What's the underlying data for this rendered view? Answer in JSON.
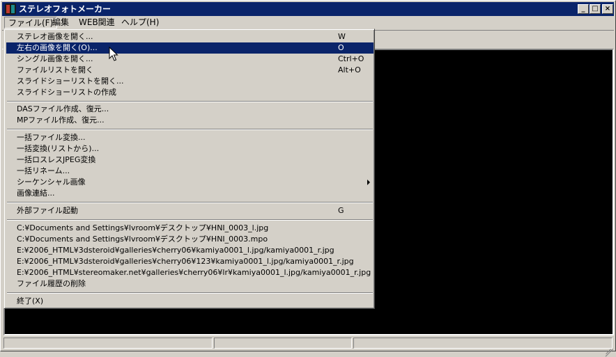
{
  "window": {
    "title": "ステレオフォトメーカー"
  },
  "title_buttons": {
    "minimize": "_",
    "maximize": "□",
    "close": "×"
  },
  "menubar": {
    "file": "ファイル(F)",
    "edit": "編集",
    "web": "WEB関連",
    "help": "ヘルプ(H)"
  },
  "file_menu": {
    "items": [
      {
        "label": "ステレオ画像を開く...",
        "shortcut": "W"
      },
      {
        "label": "左右の画像を開く(O)...",
        "shortcut": "O",
        "highlighted": true
      },
      {
        "label": "シングル画像を開く...",
        "shortcut": "Ctrl+O"
      },
      {
        "label": "ファイルリストを開く",
        "shortcut": "Alt+O"
      },
      {
        "label": "スライドショーリストを開く..."
      },
      {
        "label": "スライドショーリストの作成"
      },
      {
        "label": "DASファイル作成、復元..."
      },
      {
        "label": "MPファイル作成、復元..."
      },
      {
        "label": "一括ファイル変換..."
      },
      {
        "label": "一括変換(リストから)..."
      },
      {
        "label": "一括ロスレスJPEG変換"
      },
      {
        "label": "一括リネーム..."
      },
      {
        "label": "シーケンシャル画像",
        "submenu": true
      },
      {
        "label": "画像連結..."
      },
      {
        "label": "外部ファイル起動",
        "shortcut": "G"
      },
      {
        "label": "C:¥Documents and Settings¥lvroom¥デスクトップ¥HNI_0003_l.jpg"
      },
      {
        "label": "C:¥Documents and Settings¥lvroom¥デスクトップ¥HNI_0003.mpo"
      },
      {
        "label": "E:¥2006_HTML¥3dsteroid¥galleries¥cherry06¥kamiya0001_l.jpg/kamiya0001_r.jpg"
      },
      {
        "label": "E:¥2006_HTML¥3dsteroid¥galleries¥cherry06¥123¥kamiya0001_l.jpg/kamiya0001_r.jpg"
      },
      {
        "label": "E:¥2006_HTML¥stereomaker.net¥galleries¥cherry06¥lr¥kamiya0001_l.jpg/kamiya0001_r.jpg"
      },
      {
        "label": "ファイル履歴の削除"
      },
      {
        "label": "終了(X)"
      }
    ]
  }
}
